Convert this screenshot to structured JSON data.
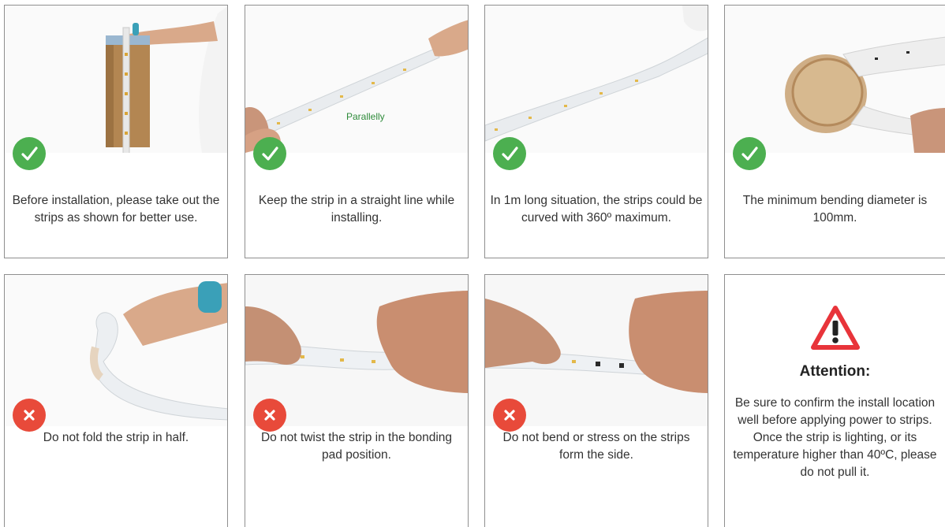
{
  "cards": [
    {
      "status": "ok",
      "caption": "Before installation, please take out the strips as shown for better use."
    },
    {
      "status": "ok",
      "caption": "Keep the strip in a straight line while installing.",
      "overlay": "Parallelly"
    },
    {
      "status": "ok",
      "caption": "In 1m long situation, the strips could be curved with 360º maximum."
    },
    {
      "status": "ok",
      "caption": "The minimum bending diameter is 100mm."
    },
    {
      "status": "no",
      "caption": "Do not fold the strip in half."
    },
    {
      "status": "no",
      "caption": "Do not twist the strip in the bonding pad position."
    },
    {
      "status": "no",
      "caption": "Do not bend or stress on the strips form the side."
    }
  ],
  "attention": {
    "title": "Attention:",
    "body": "Be sure to confirm the install location well before applying power to strips. Once the strip is lighting, or its temperature higher than 40ºC, please do not pull it.",
    "icon": "warning-triangle-icon"
  },
  "colors": {
    "ok": "#4caf50",
    "no": "#e84a3a",
    "warning": "#e8343a",
    "label_green": "#2e8b3a"
  },
  "icons": {
    "ok": "check-icon",
    "no": "cross-icon"
  }
}
